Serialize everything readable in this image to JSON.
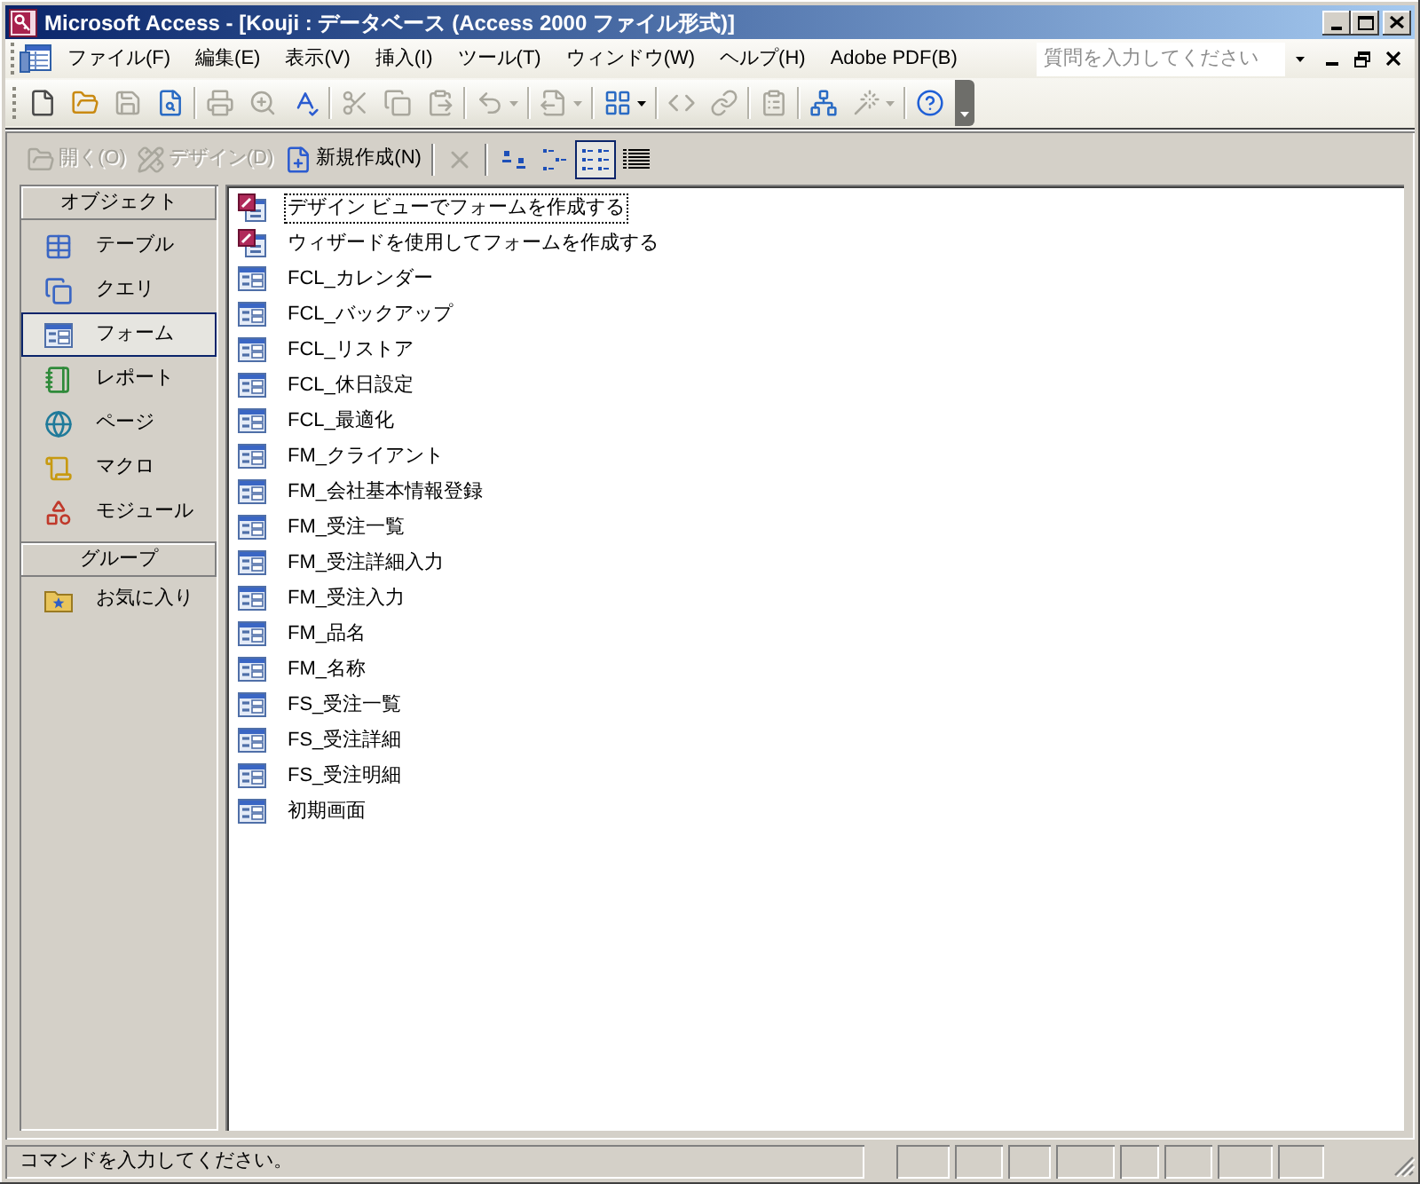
{
  "window": {
    "title": "Microsoft Access - [Kouji : データベース (Access 2000 ファイル形式)]"
  },
  "menu_bar": {
    "items": [
      "ファイル(F)",
      "編集(E)",
      "表示(V)",
      "挿入(I)",
      "ツール(T)",
      "ウィンドウ(W)",
      "ヘルプ(H)",
      "Adobe PDF(B)"
    ],
    "help_search": {
      "placeholder": "質問を入力してください"
    }
  },
  "toolbar": {
    "groups": [
      [
        {
          "kind": "new",
          "disabled": false,
          "dropdown": false
        },
        {
          "kind": "open",
          "disabled": false,
          "dropdown": false
        },
        {
          "kind": "save",
          "disabled": true,
          "dropdown": false
        },
        {
          "kind": "file_search",
          "disabled": false,
          "dropdown": false
        }
      ],
      [
        {
          "kind": "print",
          "disabled": true,
          "dropdown": false
        },
        {
          "kind": "print_preview",
          "disabled": true,
          "dropdown": false
        },
        {
          "kind": "spelling",
          "disabled": false,
          "dropdown": false
        }
      ],
      [
        {
          "kind": "cut",
          "disabled": true,
          "dropdown": false
        },
        {
          "kind": "copy",
          "disabled": true,
          "dropdown": false
        },
        {
          "kind": "paste",
          "disabled": true,
          "dropdown": false
        }
      ],
      [
        {
          "kind": "undo",
          "disabled": true,
          "dropdown": true
        }
      ],
      [
        {
          "kind": "office_links",
          "disabled": true,
          "dropdown": true
        }
      ],
      [
        {
          "kind": "analyze",
          "disabled": false,
          "dropdown": true
        }
      ],
      [
        {
          "kind": "code",
          "disabled": true,
          "dropdown": false
        },
        {
          "kind": "script",
          "disabled": true,
          "dropdown": false
        }
      ],
      [
        {
          "kind": "properties",
          "disabled": true,
          "dropdown": false
        }
      ],
      [
        {
          "kind": "relationships",
          "disabled": false,
          "dropdown": false
        },
        {
          "kind": "new_object",
          "disabled": true,
          "dropdown": true
        }
      ],
      [
        {
          "kind": "help",
          "disabled": false,
          "dropdown": false
        }
      ]
    ]
  },
  "database_toolbar": {
    "buttons": [
      {
        "kind": "open",
        "label": "開く(O)",
        "disabled": true
      },
      {
        "kind": "design",
        "label": "デザイン(D)",
        "disabled": true
      },
      {
        "kind": "new",
        "label": "新規作成(N)",
        "disabled": false
      }
    ],
    "delete": {
      "disabled": true
    },
    "views": [
      {
        "kind": "large_icons",
        "selected": false
      },
      {
        "kind": "small_icons",
        "selected": false
      },
      {
        "kind": "list",
        "selected": true
      },
      {
        "kind": "details",
        "selected": false
      }
    ]
  },
  "objects_bar": {
    "header": "オブジェクト",
    "items": [
      {
        "kind": "table",
        "label": "テーブル",
        "selected": false
      },
      {
        "kind": "query",
        "label": "クエリ",
        "selected": false
      },
      {
        "kind": "form",
        "label": "フォーム",
        "selected": true
      },
      {
        "kind": "report",
        "label": "レポート",
        "selected": false
      },
      {
        "kind": "page",
        "label": "ページ",
        "selected": false
      },
      {
        "kind": "macro",
        "label": "マクロ",
        "selected": false
      },
      {
        "kind": "module",
        "label": "モジュール",
        "selected": false
      }
    ],
    "groups_header": "グループ",
    "groups": [
      {
        "kind": "favorites",
        "label": "お気に入り",
        "selected": false
      }
    ]
  },
  "object_list": {
    "items": [
      {
        "kind": "shortcut",
        "label": "デザイン ビューでフォームを作成する",
        "focused": true
      },
      {
        "kind": "shortcut",
        "label": "ウィザードを使用してフォームを作成する",
        "focused": false
      },
      {
        "kind": "form",
        "label": "FCL_カレンダー",
        "focused": false
      },
      {
        "kind": "form",
        "label": "FCL_バックアップ",
        "focused": false
      },
      {
        "kind": "form",
        "label": "FCL_リストア",
        "focused": false
      },
      {
        "kind": "form",
        "label": "FCL_休日設定",
        "focused": false
      },
      {
        "kind": "form",
        "label": "FCL_最適化",
        "focused": false
      },
      {
        "kind": "form",
        "label": "FM_クライアント",
        "focused": false
      },
      {
        "kind": "form",
        "label": "FM_会社基本情報登録",
        "focused": false
      },
      {
        "kind": "form",
        "label": "FM_受注一覧",
        "focused": false
      },
      {
        "kind": "form",
        "label": "FM_受注詳細入力",
        "focused": false
      },
      {
        "kind": "form",
        "label": "FM_受注入力",
        "focused": false
      },
      {
        "kind": "form",
        "label": "FM_品名",
        "focused": false
      },
      {
        "kind": "form",
        "label": "FM_名称",
        "focused": false
      },
      {
        "kind": "form",
        "label": "FS_受注一覧",
        "focused": false
      },
      {
        "kind": "form",
        "label": "FS_受注詳細",
        "focused": false
      },
      {
        "kind": "form",
        "label": "FS_受注明細",
        "focused": false
      },
      {
        "kind": "form",
        "label": "初期画面",
        "focused": false
      }
    ]
  },
  "status_bar": {
    "text": "コマンドを入力してください。"
  }
}
